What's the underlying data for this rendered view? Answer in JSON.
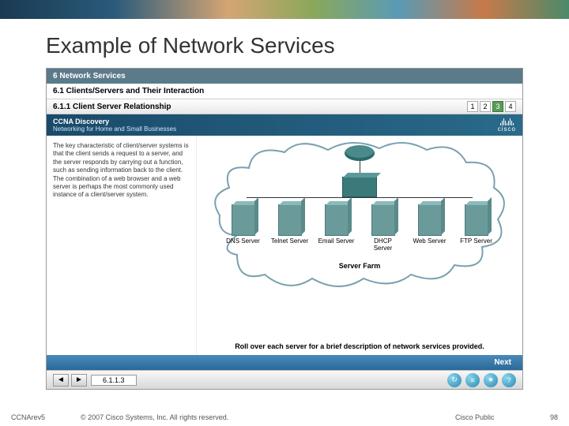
{
  "header": {
    "photo_alt": "people-banner"
  },
  "slide": {
    "title": "Example of Network Services"
  },
  "module": {
    "chapter": "6 Network Services",
    "section": "6.1 Clients/Servers and Their Interaction",
    "subsection": "6.1.1 Client Server Relationship",
    "pages": [
      "1",
      "2",
      "3",
      "4"
    ],
    "active_page": "3"
  },
  "banner": {
    "brand": "CCNA Discovery",
    "sub": "Networking for Home and Small Businesses",
    "logo": "cisco"
  },
  "body": {
    "description": "The key characteristic of client/server systems is that the client sends a request to a server, and the server responds by carrying out a function, such as sending information back to the client. The combination of a web browser and a web server is perhaps the most commonly used instance of a client/server system.",
    "servers": [
      {
        "label": "DNS Server"
      },
      {
        "label": "Telnet Server"
      },
      {
        "label": "Email Server"
      },
      {
        "label": "DHCP Server"
      },
      {
        "label": "Web Server"
      },
      {
        "label": "FTP Server"
      }
    ],
    "farm_label": "Server Farm",
    "instruction": "Roll over each server for a brief description of network services provided."
  },
  "controls": {
    "next": "Next",
    "prev_arrow": "◄",
    "next_arrow": "►",
    "index": "6.1.1.3",
    "icons": {
      "restart": "↻",
      "toc": "≡",
      "glossary": "★",
      "help": "?"
    }
  },
  "footer": {
    "left": "CCNArev5",
    "copyright": "© 2007 Cisco Systems, Inc. All rights reserved.",
    "mid": "Cisco Public",
    "page": "98"
  }
}
